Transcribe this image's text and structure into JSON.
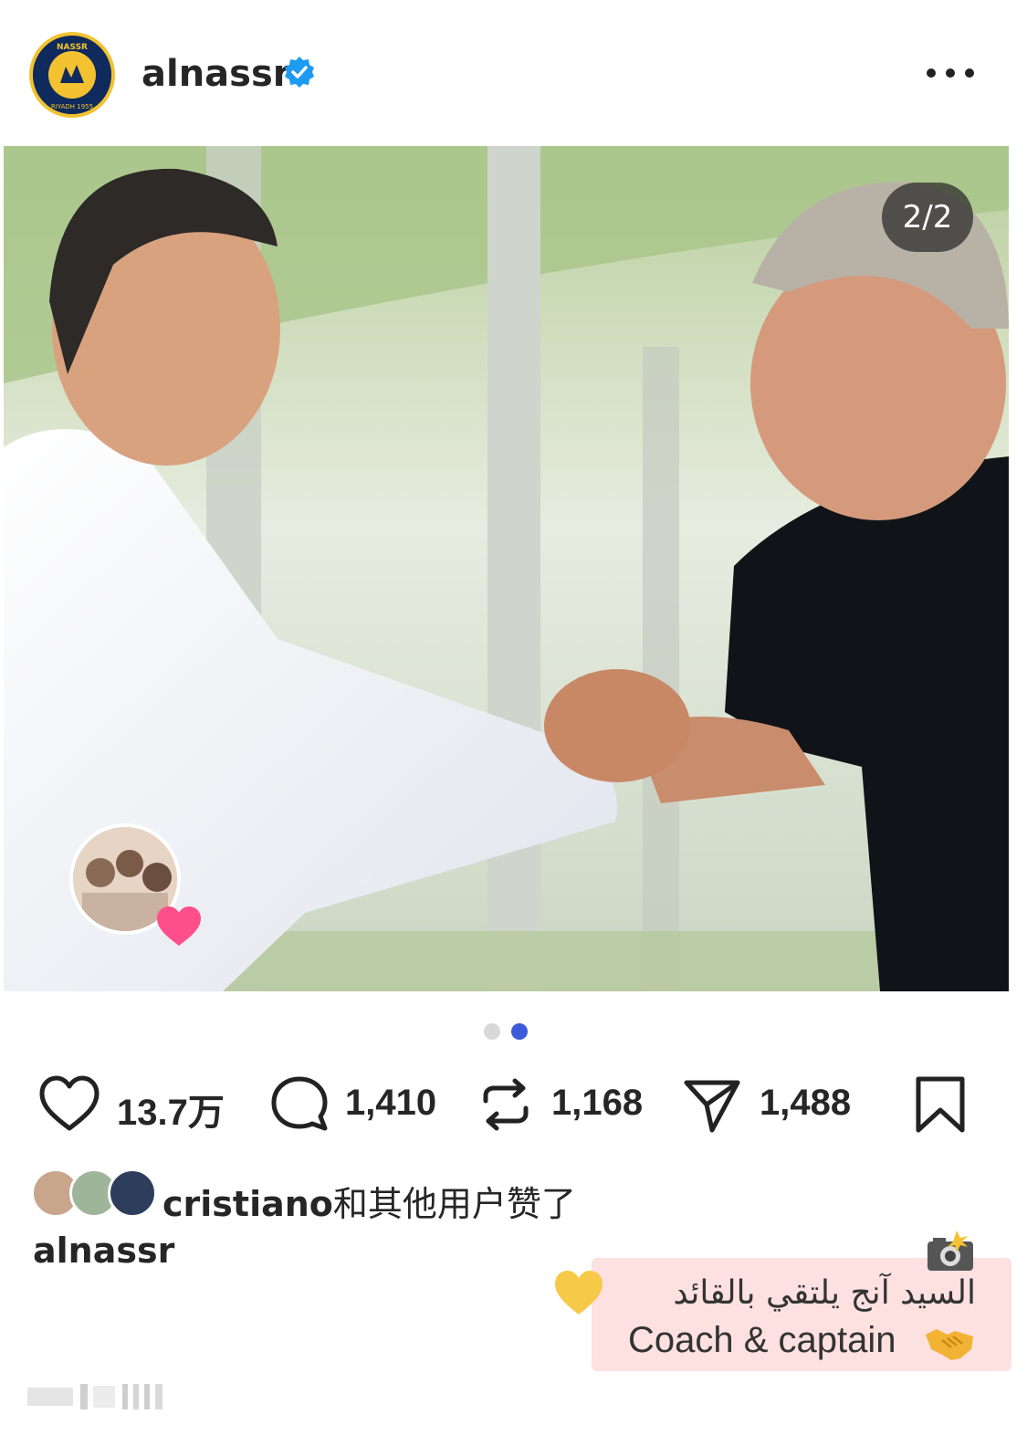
{
  "header": {
    "username": "alnassr",
    "verified_icon": "verified-badge-icon",
    "more_icon": "more-options-icon",
    "logo_text_top": "NASSR",
    "logo_text_bottom": "RIYADH 1955"
  },
  "photo": {
    "counter": "2/2"
  },
  "carousel": {
    "current": 2,
    "total": 2
  },
  "actions": {
    "likes": "13.7万",
    "comments": "1,410",
    "reposts": "1,168",
    "shares": "1,488"
  },
  "liked_by": {
    "user": "cristiano",
    "suffix": "和其他用户赞了"
  },
  "caption": {
    "user": "alnassr",
    "arabic": "السيد آنج يلتقي بالقائد",
    "english": "Coach & captain"
  },
  "colors": {
    "accent": "#3b5bdb",
    "verified": "#1d9bf0",
    "caption_bg": "#fde0e0",
    "logo_navy": "#0f2a5c",
    "logo_gold": "#f2c230"
  }
}
